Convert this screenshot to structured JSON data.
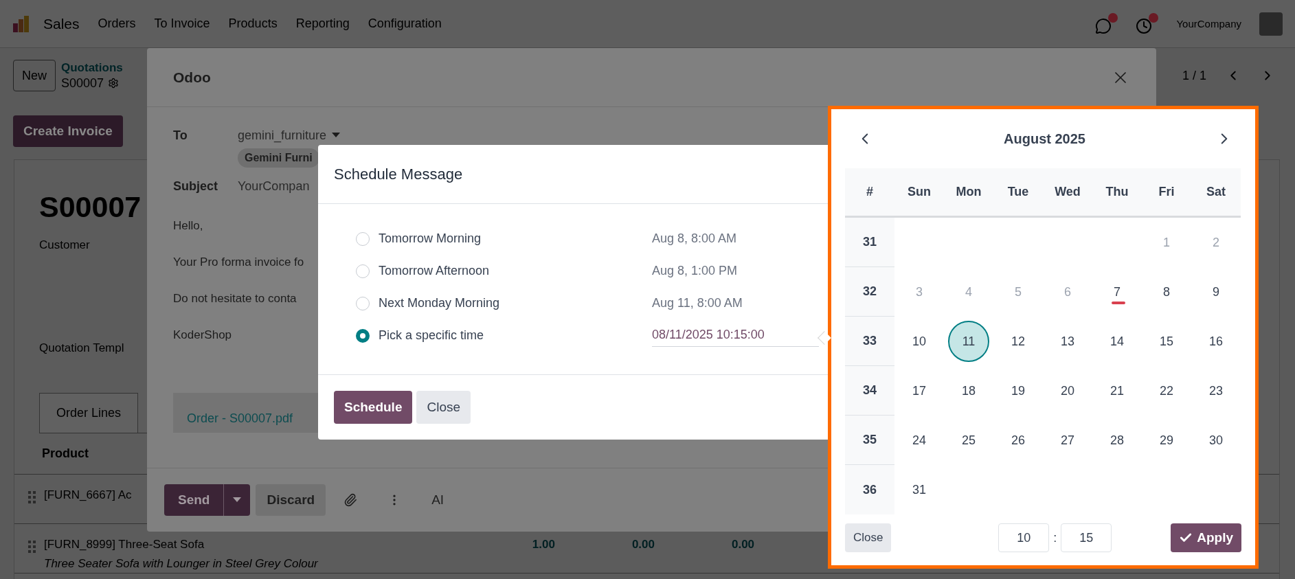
{
  "navbar": {
    "app": "Sales",
    "menu": [
      "Orders",
      "To Invoice",
      "Products",
      "Reporting",
      "Configuration"
    ],
    "company": "YourCompany"
  },
  "control_panel": {
    "new_button": "New",
    "breadcrumb": "Quotations",
    "record": "S00007",
    "pager": "1 / 1"
  },
  "actions": [
    "Create Invoice"
  ],
  "sheet": {
    "title": "S00007",
    "fields": [
      "Customer",
      "Quotation Templ"
    ],
    "tabs": [
      {
        "label": "Order Lines",
        "selected": true
      }
    ],
    "columns": [
      "Product"
    ],
    "rows": [
      {
        "product": "[FURN_6667] Ac"
      },
      {
        "product": "[FURN_8999] Three-Seat Sofa",
        "description": "Three Seater Sofa with Lounger in Steel Grey Colour",
        "values": [
          "1.00",
          "0.00",
          "0.00"
        ]
      }
    ]
  },
  "composer": {
    "title": "Odoo",
    "to_label": "To",
    "recipient": "gemini_furniture",
    "tag": "Gemini Furni",
    "subject_label": "Subject",
    "subject": "YourCompan",
    "body": [
      "Hello,",
      "Your Pro forma invoice fo",
      "Do not hesitate to conta",
      "KoderShop"
    ],
    "attachment": "Order - S00007.pdf",
    "send": "Send",
    "discard": "Discard",
    "ai": "AI"
  },
  "schedule": {
    "title": "Schedule Message",
    "options": [
      {
        "label": "Tomorrow Morning",
        "time": "Aug 8, 8:00 AM",
        "kind": "text",
        "selected": false
      },
      {
        "label": "Tomorrow Afternoon",
        "time": "Aug 8, 1:00 PM",
        "kind": "text",
        "selected": false
      },
      {
        "label": "Next Monday Morning",
        "time": "Aug 11, 8:00 AM",
        "kind": "text",
        "selected": false
      },
      {
        "label": "Pick a specific time",
        "time": "08/11/2025 10:15:00",
        "kind": "input",
        "selected": true
      }
    ],
    "buttons": [
      {
        "label": "Schedule",
        "kind": "primary"
      },
      {
        "label": "Close",
        "kind": "secondary"
      }
    ]
  },
  "calendar": {
    "month": "August 2025",
    "week_header": "#",
    "weekdays": [
      "Sun",
      "Mon",
      "Tue",
      "Wed",
      "Thu",
      "Fri",
      "Sat"
    ],
    "weeks": [
      {
        "number": "31",
        "days": [
          {
            "kind": "blank"
          },
          {
            "kind": "blank"
          },
          {
            "kind": "blank"
          },
          {
            "kind": "blank"
          },
          {
            "kind": "blank"
          },
          {
            "kind": "day",
            "label": "1",
            "muted": true,
            "today": false,
            "selected": false
          },
          {
            "label": "2",
            "muted": true,
            "today": false,
            "selected": false
          }
        ]
      },
      {
        "number": "32",
        "days": [
          {
            "label": "3",
            "muted": true,
            "today": false,
            "selected": false
          },
          {
            "label": "4",
            "muted": true,
            "today": false,
            "selected": false
          },
          {
            "label": "5",
            "muted": true,
            "today": false,
            "selected": false
          },
          {
            "label": "6",
            "muted": true,
            "today": false,
            "selected": false
          },
          {
            "label": "7",
            "muted": false,
            "today": true,
            "selected": false
          },
          {
            "label": "8",
            "muted": false,
            "today": false,
            "selected": false
          },
          {
            "label": "9",
            "muted": false,
            "today": false,
            "selected": false
          }
        ]
      },
      {
        "number": "33",
        "days": [
          {
            "label": "10",
            "muted": false,
            "today": false,
            "selected": false
          },
          {
            "label": "11",
            "muted": false,
            "today": false,
            "selected": true
          },
          {
            "label": "12",
            "muted": false,
            "today": false,
            "selected": false
          },
          {
            "label": "13",
            "muted": false,
            "today": false,
            "selected": false
          },
          {
            "label": "14",
            "muted": false,
            "today": false,
            "selected": false
          },
          {
            "label": "15",
            "muted": false,
            "today": false,
            "selected": false
          },
          {
            "label": "16",
            "muted": false,
            "today": false,
            "selected": false
          }
        ]
      },
      {
        "number": "34",
        "days": [
          {
            "label": "17",
            "muted": false,
            "today": false,
            "selected": false
          },
          {
            "label": "18",
            "muted": false,
            "today": false,
            "selected": false
          },
          {
            "label": "19",
            "muted": false,
            "today": false,
            "selected": false
          },
          {
            "label": "20",
            "muted": false,
            "today": false,
            "selected": false
          },
          {
            "label": "21",
            "muted": false,
            "today": false,
            "selected": false
          },
          {
            "label": "22",
            "muted": false,
            "today": false,
            "selected": false
          },
          {
            "label": "23",
            "muted": false,
            "today": false,
            "selected": false
          }
        ]
      },
      {
        "number": "35",
        "days": [
          {
            "label": "24",
            "muted": false,
            "today": false,
            "selected": false
          },
          {
            "label": "25",
            "muted": false,
            "today": false,
            "selected": false
          },
          {
            "label": "26",
            "muted": false,
            "today": false,
            "selected": false
          },
          {
            "label": "27",
            "muted": false,
            "today": false,
            "selected": false
          },
          {
            "label": "28",
            "muted": false,
            "today": false,
            "selected": false
          },
          {
            "label": "29",
            "muted": false,
            "today": false,
            "selected": false
          },
          {
            "label": "30",
            "muted": false,
            "today": false,
            "selected": false
          }
        ]
      },
      {
        "number": "36",
        "days": [
          {
            "label": "31",
            "muted": false,
            "today": false,
            "selected": false
          }
        ]
      }
    ],
    "close": "Close",
    "hour": "10",
    "separator": ":",
    "minute": "15",
    "apply": "Apply"
  }
}
